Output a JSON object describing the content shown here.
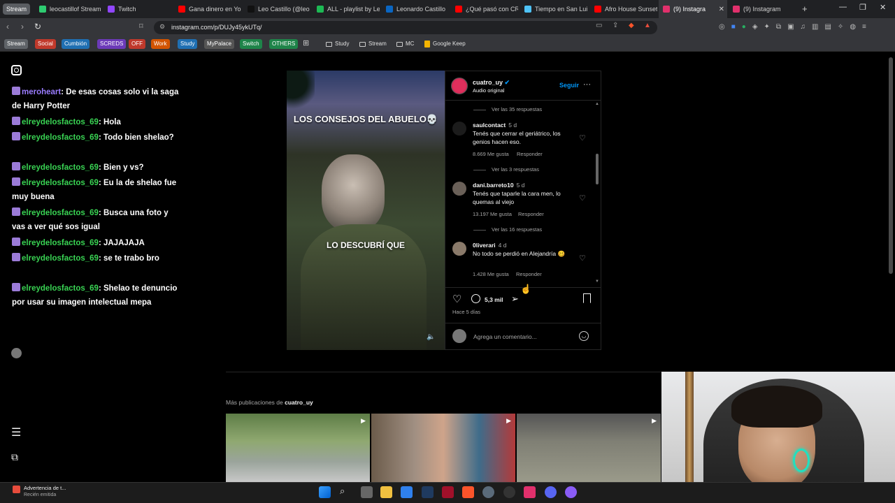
{
  "browser": {
    "group_label": "Stream",
    "tabs": [
      {
        "label": "leocastillof Stream",
        "color": "#2ecc71"
      },
      {
        "label": "Twitch",
        "color": "#9146ff"
      },
      {
        "label": "Gana dinero en Yo",
        "color": "#ff0000"
      },
      {
        "label": "Leo Castillo (@leo",
        "color": "#111111"
      },
      {
        "label": "ALL - playlist by Le",
        "color": "#1db954"
      },
      {
        "label": "Leonardo Castillo",
        "color": "#0a66c2"
      },
      {
        "label": "¿Qué pasó con CR",
        "color": "#ff0000"
      },
      {
        "label": "Tiempo en San Lui",
        "color": "#4fc3f7"
      },
      {
        "label": "Afro House Sunset",
        "color": "#ff0000"
      },
      {
        "label": "(9) Instagra",
        "color": "#e1306c"
      },
      {
        "label": "(9) Instagram",
        "color": "#e1306c"
      }
    ],
    "new_tab": "+",
    "url": "instagram.com/p/DUJy45ykUTq/",
    "bookmarks": [
      {
        "label": "Stream",
        "color": "#5f6368"
      },
      {
        "label": "Social",
        "color": "#c0392b"
      },
      {
        "label": "Cumbión",
        "color": "#1f6fb2"
      },
      {
        "label": "SCREDS",
        "color": "#6c3ab8"
      },
      {
        "label": "OFF",
        "color": "#c0392b"
      },
      {
        "label": "Work",
        "color": "#d35400"
      },
      {
        "label": "Study",
        "color": "#1f6fb2"
      },
      {
        "label": "MyPalace",
        "color": "#555555"
      },
      {
        "label": "Switch",
        "color": "#1e8449"
      },
      {
        "label": "OTHERS",
        "color": "#1e8449"
      }
    ],
    "bookmark_folders": [
      "Study",
      "Stream",
      "MC",
      "Google Keep"
    ]
  },
  "chat": [
    {
      "user": "meroheart",
      "color": "purple",
      "text": ": De esas cosas solo vi la saga de Harry Potter"
    },
    {
      "user": "elreydelosfactos_69",
      "color": "green",
      "text": ": Hola"
    },
    {
      "user": "elreydelosfactos_69",
      "color": "green",
      "text": ": Todo bien shelao?"
    },
    {
      "user": "elreydelosfactos_69",
      "color": "green",
      "text": ": Bien y vs?"
    },
    {
      "user": "elreydelosfactos_69",
      "color": "green",
      "text": ": Eu la de shelao fue muy buena"
    },
    {
      "user": "elreydelosfactos_69",
      "color": "green",
      "text": ": Busca una foto y vas a ver qué sos igual"
    },
    {
      "user": "elreydelosfactos_69",
      "color": "green",
      "text": ": JAJAJAJA"
    },
    {
      "user": "elreydelosfactos_69",
      "color": "green",
      "text": ": se te trabo bro"
    },
    {
      "user": "elreydelosfactos_69",
      "color": "green",
      "text": ": Shelao te denuncio por usar su imagen intelectual mepa"
    }
  ],
  "post": {
    "video_caption_top": "LOS CONSEJOS DEL ABUELO💀",
    "video_caption_mid": "LO DESCUBRÍ QUE",
    "author": "cuatro_uy",
    "audio": "Audio original",
    "follow": "Seguir",
    "more": "···",
    "comments": [
      {
        "replies_above": "Ver las 35 respuestas",
        "user": "saulcontact",
        "time": "5 d",
        "text": "Tenés que cerrar el geriátrico, los genios hacen eso.",
        "likes": "8.669 Me gusta",
        "reply": "Responder"
      },
      {
        "replies_above": "Ver las 3 respuestas",
        "user": "dani.barreto10",
        "time": "5 d",
        "text": "Tenés que taparle la cara men, lo quemas al viejo",
        "likes": "13.197 Me gusta",
        "reply": "Responder"
      },
      {
        "replies_above": "Ver las 16 respuestas",
        "user": "0liverari",
        "time": "4 d",
        "text": "No todo se perdió en Alejandría 🥴",
        "likes": "1.428 Me gusta",
        "reply": "Responder"
      }
    ],
    "comment_count": "5,3 mil",
    "posted_ago": "Hace 5 días",
    "comment_placeholder": "Agrega un comentario..."
  },
  "more_posts": {
    "label": "Más publicaciones de ",
    "author": "cuatro_uy"
  },
  "notification": {
    "title": "Advertencia de t...",
    "subtitle": "Recién emitida"
  }
}
